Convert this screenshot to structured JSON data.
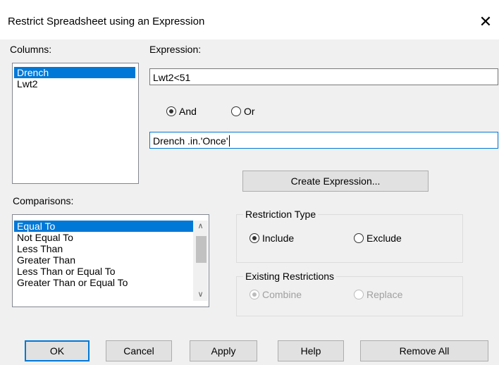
{
  "dialog": {
    "title": "Restrict Spreadsheet using an Expression",
    "close_glyph": "✕"
  },
  "columns": {
    "label": "Columns:",
    "items": [
      "Drench",
      "Lwt2"
    ],
    "selected": "Drench"
  },
  "expression": {
    "label": "Expression:",
    "value1": "Lwt2<51",
    "value2": "Drench .in.'Once'",
    "and_label": "And",
    "or_label": "Or",
    "selected_operator": "And"
  },
  "comparisons": {
    "label": "Comparisons:",
    "items": [
      "Equal To",
      "Not Equal To",
      "Less Than",
      "Greater Than",
      "Less Than or Equal To",
      "Greater Than or Equal To"
    ],
    "selected": "Equal To",
    "scroll_up": "∧",
    "scroll_down": "∨"
  },
  "create_expression_label": "Create Expression...",
  "restriction_type": {
    "title": "Restriction Type",
    "include_label": "Include",
    "exclude_label": "Exclude",
    "selected": "Include"
  },
  "existing_restrictions": {
    "title": "Existing Restrictions",
    "combine_label": "Combine",
    "replace_label": "Replace",
    "selected": "Combine",
    "disabled": true
  },
  "buttons": {
    "ok": "OK",
    "cancel": "Cancel",
    "apply": "Apply",
    "help": "Help",
    "remove_all": "Remove All"
  },
  "colors": {
    "selection": "#0078d7",
    "dialog_bg": "#f0f0f0"
  }
}
